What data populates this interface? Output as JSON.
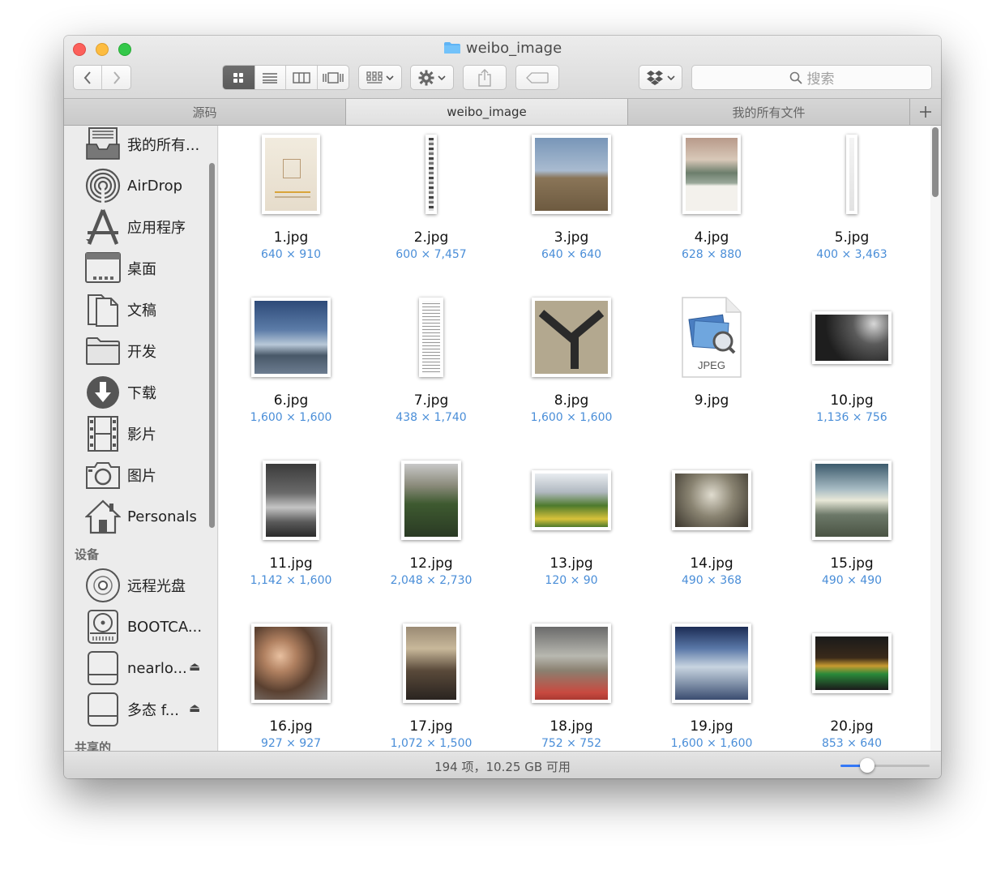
{
  "window": {
    "title": "weibo_image"
  },
  "toolbar": {
    "search_placeholder": "搜索"
  },
  "tabs": [
    {
      "label": "源码",
      "active": false
    },
    {
      "label": "weibo_image",
      "active": true
    },
    {
      "label": "我的所有文件",
      "active": false
    }
  ],
  "sidebar": {
    "favorites": [
      {
        "label": "我的所有...",
        "icon": "all-files-icon"
      },
      {
        "label": "AirDrop",
        "icon": "airdrop-icon"
      },
      {
        "label": "应用程序",
        "icon": "applications-icon"
      },
      {
        "label": "桌面",
        "icon": "desktop-icon"
      },
      {
        "label": "文稿",
        "icon": "documents-icon"
      },
      {
        "label": "开发",
        "icon": "folder-icon"
      },
      {
        "label": "下载",
        "icon": "downloads-icon"
      },
      {
        "label": "影片",
        "icon": "movies-icon"
      },
      {
        "label": "图片",
        "icon": "pictures-icon"
      },
      {
        "label": "Personals",
        "icon": "home-icon"
      }
    ],
    "devices_header": "设备",
    "devices": [
      {
        "label": "远程光盘",
        "icon": "remote-disc-icon"
      },
      {
        "label": "BOOTCA...",
        "icon": "bootcamp-disk-icon"
      },
      {
        "label": "nearlo...",
        "icon": "external-disk-icon",
        "eject": "⏏"
      },
      {
        "label": "多态 f...",
        "icon": "external-disk-icon",
        "eject": "⏏"
      }
    ],
    "shared_header": "共享的"
  },
  "files": [
    {
      "name": "1.jpg",
      "dims": "640 × 910"
    },
    {
      "name": "2.jpg",
      "dims": "600 × 7,457"
    },
    {
      "name": "3.jpg",
      "dims": "640 × 640"
    },
    {
      "name": "4.jpg",
      "dims": "628 × 880"
    },
    {
      "name": "5.jpg",
      "dims": "400 × 3,463"
    },
    {
      "name": "6.jpg",
      "dims": "1,600 × 1,600"
    },
    {
      "name": "7.jpg",
      "dims": "438 × 1,740"
    },
    {
      "name": "8.jpg",
      "dims": "1,600 × 1,600"
    },
    {
      "name": "9.jpg",
      "dims": "",
      "generic_label": "JPEG"
    },
    {
      "name": "10.jpg",
      "dims": "1,136 × 756"
    },
    {
      "name": "11.jpg",
      "dims": "1,142 × 1,600"
    },
    {
      "name": "12.jpg",
      "dims": "2,048 × 2,730"
    },
    {
      "name": "13.jpg",
      "dims": "120 × 90"
    },
    {
      "name": "14.jpg",
      "dims": "490 × 368"
    },
    {
      "name": "15.jpg",
      "dims": "490 × 490"
    },
    {
      "name": "16.jpg",
      "dims": "927 × 927"
    },
    {
      "name": "17.jpg",
      "dims": "1,072 × 1,500"
    },
    {
      "name": "18.jpg",
      "dims": "752 × 752"
    },
    {
      "name": "19.jpg",
      "dims": "1,600 × 1,600"
    },
    {
      "name": "20.jpg",
      "dims": "853 × 640"
    }
  ],
  "status": {
    "text": "194 项，10.25 GB 可用",
    "zoom_level": 0.3
  },
  "colors": {
    "accent": "#3478f6",
    "dimension_text": "#4a8ed8",
    "close": "#fc605b",
    "minimize": "#fdbc40",
    "zoom": "#34c84a"
  }
}
